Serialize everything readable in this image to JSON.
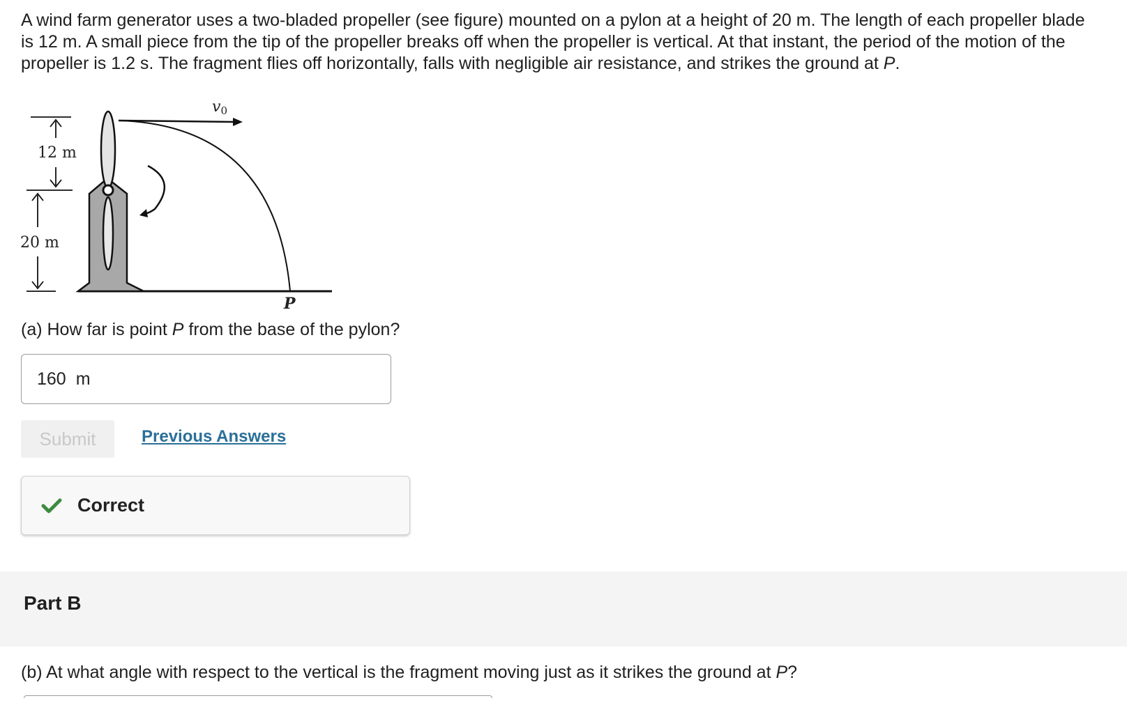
{
  "problem": {
    "text_1": "A wind farm generator uses a two-bladed propeller (see figure) mounted on a pylon at a height of 20 m. The length of each propeller blade is 12 m. A small piece from the tip of the propeller breaks off when the propeller is vertical. At that instant, the period of the motion of the propeller is 1.2 s. The fragment flies off horizontally, falls with negligible air resistance, and strikes the ground at ",
    "point_label": "P",
    "text_2": "."
  },
  "figure": {
    "blade_label": "12 m",
    "pylon_label": "20 m",
    "velocity_label": "v",
    "velocity_subscript": "0",
    "point_label": "P"
  },
  "part_a": {
    "question_1": "(a) How far is point ",
    "question_point": "P",
    "question_2": " from the base of the pylon?",
    "answer_value": "160",
    "answer_unit": "m",
    "submit_label": "Submit",
    "previous_answers_label": "Previous Answers",
    "feedback_label": "Correct",
    "feedback_color": "#3c8c40"
  },
  "part_b": {
    "title": "Part B",
    "question_1": "(b) At what angle with respect to the vertical is the fragment moving just as it strikes the ground at ",
    "question_point": "P",
    "question_2": "?"
  }
}
